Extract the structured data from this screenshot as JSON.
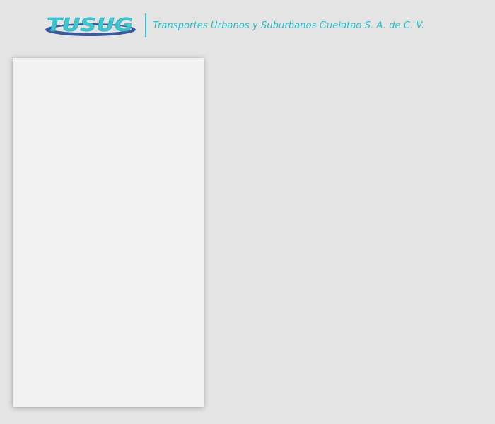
{
  "header": {
    "logo_text": "TUSUG",
    "company_name": "Transportes Urbanos y Suburbanos Guelatao S. A. de C. V."
  },
  "colors": {
    "background": "#e4e4e4",
    "accent": "#25c1ce",
    "logo_swoosh": "#3a5a9c",
    "panel": "#f2f2f2"
  },
  "panel": {
    "items": []
  }
}
